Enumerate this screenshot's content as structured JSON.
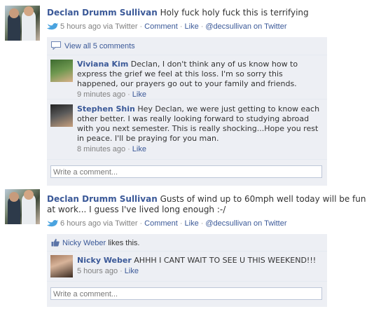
{
  "stories": [
    {
      "author": "Declan Drumm Sullivan",
      "message": "Holy fuck holy fuck this is terrifying",
      "meta": {
        "time": "5 hours ago",
        "via": "via Twitter",
        "comment": "Comment",
        "like": "Like",
        "handle": "@decsullivan on Twitter"
      },
      "view_all": "View all 5 comments",
      "comments": [
        {
          "name": "Viviana Kim",
          "text": "Declan, I don't think any of us know how to express the grief we feel at this loss. I'm so sorry this happened, our prayers go out to your family and friends.",
          "time": "9 minutes ago",
          "like": "Like"
        },
        {
          "name": "Stephen Shin",
          "text": "Hey Declan, we were just getting to know each other better. I was really looking forward to studying abroad with you next semester. This is really shocking...Hope you rest in peace. I'll be praying for you man.",
          "time": "8 minutes ago",
          "like": "Like"
        }
      ],
      "comment_placeholder": "Write a comment..."
    },
    {
      "author": "Declan Drumm Sullivan",
      "message": "Gusts of wind up to 60mph well today will be fun at work... I guess I've lived long enough :-/",
      "meta": {
        "time": "6 hours ago",
        "via": "via Twitter",
        "comment": "Comment",
        "like": "Like",
        "handle": "@decsullivan on Twitter"
      },
      "likes": {
        "name": "Nicky Weber",
        "suffix": "likes this."
      },
      "comments": [
        {
          "name": "Nicky Weber",
          "text": "AHHH I CANT WAIT TO SEE U THIS WEEKEND!!!",
          "time": "5 hours ago",
          "like": "Like"
        }
      ],
      "comment_placeholder": "Write a comment..."
    }
  ],
  "colors": {
    "link": "#3b5998",
    "ufi_background": "#edeff4",
    "meta_text": "#808080"
  }
}
